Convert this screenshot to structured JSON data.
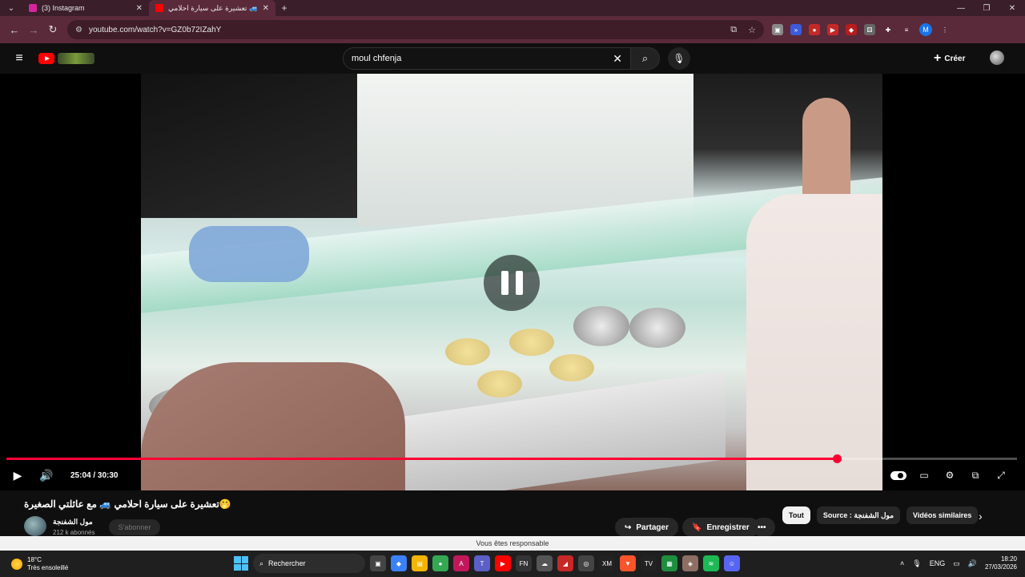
{
  "browser": {
    "tabs": [
      {
        "label": "(3) Instagram",
        "favicon_color": "#d6249f"
      },
      {
        "label": "تعشيرة على سيارة احلامي 🚙",
        "favicon_color": "#ff0000"
      }
    ],
    "url": "youtube.com/watch?v=GZ0b72IZahY",
    "profile_letter": "M"
  },
  "youtube": {
    "search_query": "moul chfenja",
    "create_label": "Créer"
  },
  "player": {
    "current_time": "25:04 / 30:30",
    "progress": 0.8218
  },
  "video": {
    "title": "🤭تعشيرة على سيارة احلامي 🚙 مع عائلتي الصغيرة",
    "channel_name": "مول الشفنجة",
    "subscribers": "212 k abonnés",
    "subscribe_label": "S'abonner",
    "share_label": "Partager",
    "save_label": "Enregistrer",
    "more_label": "•••"
  },
  "chips": [
    {
      "label": "Tout"
    },
    {
      "label": "Source : مول الشفنجة"
    },
    {
      "label": "Vidéos similaires"
    }
  ],
  "notice": "Vous êtes responsable",
  "taskbar": {
    "temperature": "18°C",
    "weather": "Très ensoleillé",
    "search_label": "Rechercher",
    "lang": "ENG",
    "time": "18:20",
    "date": "27/03/2026"
  }
}
